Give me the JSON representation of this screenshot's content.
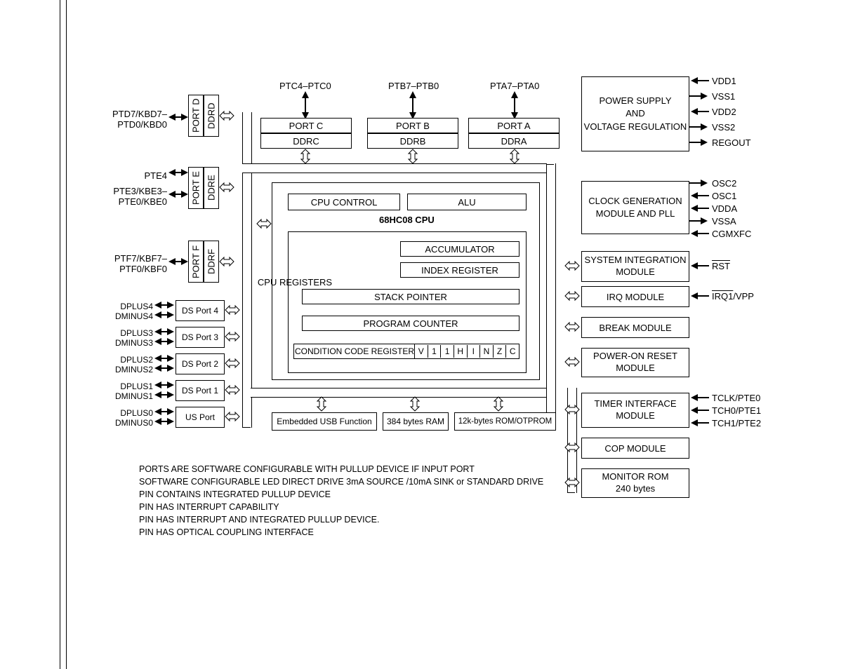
{
  "top_ports": {
    "ptc": "PTC4–PTC0",
    "ptb": "PTB7–PTB0",
    "pta": "PTA7–PTA0"
  },
  "portABC": {
    "portc": "PORT C",
    "ddrc": "DDRC",
    "portb": "PORT B",
    "ddrb": "DDRB",
    "porta": "PORT A",
    "ddra": "DDRA"
  },
  "left_ports": {
    "d": {
      "pin": "PTD7/KBD7–\nPTD0/KBD0",
      "port": "PORT D",
      "ddr": "DDRD"
    },
    "e": {
      "pin4": "PTE4",
      "pin": "PTE3/KBE3–\nPTE0/KBE0",
      "port": "PORT E",
      "ddr": "DDRE"
    },
    "f": {
      "pin": "PTF7/KBF7–\nPTF0/KBF0",
      "port": "PORT F",
      "ddr": "DDRF"
    }
  },
  "ds_ports": {
    "dp4": {
      "p": "DPLUS4",
      "m": "DMINUS4",
      "box": "DS Port 4"
    },
    "dp3": {
      "p": "DPLUS3",
      "m": "DMINUS3",
      "box": "DS Port 3"
    },
    "dp2": {
      "p": "DPLUS2",
      "m": "DMINUS2",
      "box": "DS Port 2"
    },
    "dp1": {
      "p": "DPLUS1",
      "m": "DMINUS1",
      "box": "DS Port 1"
    },
    "dp0": {
      "p": "DPLUS0",
      "m": "DMINUS0",
      "box": "US Port"
    }
  },
  "cpu": {
    "title": "68HC08 CPU",
    "ctrl": "CPU CONTROL",
    "alu": "ALU",
    "regs": "CPU REGISTERS",
    "acc": "ACCUMULATOR",
    "idx": "INDEX REGISTER",
    "sp": "STACK POINTER",
    "pc": "PROGRAM COUNTER",
    "ccr": "CONDITION CODE REGISTER",
    "ccr_bits": [
      "V",
      "1",
      "1",
      "H",
      "I",
      "N",
      "Z",
      "C"
    ]
  },
  "mem": {
    "usb": "Embedded USB Function",
    "ram": "384 bytes RAM",
    "rom": "12k-bytes ROM/OTPROM"
  },
  "power": {
    "title1": "POWER SUPPLY",
    "title2": "AND",
    "title3": "VOLTAGE REGULATION",
    "pins": [
      "VDD1",
      "VSS1",
      "VDD2",
      "VSS2",
      "REGOUT"
    ]
  },
  "clock": {
    "title1": "CLOCK GENERATION",
    "title2": "MODULE AND PLL",
    "pins": [
      "OSC2",
      "OSC1",
      "VDDA",
      "VSSA",
      "CGMXFC"
    ]
  },
  "modules": {
    "sim": {
      "t1": "SYSTEM INTEGRATION",
      "t2": "MODULE",
      "pin": "RST"
    },
    "irq": {
      "t": "IRQ MODULE",
      "pin": "IRQ1/VPP"
    },
    "brk": {
      "t": "BREAK MODULE"
    },
    "por": {
      "t1": "POWER-ON RESET",
      "t2": "MODULE"
    },
    "tim": {
      "t1": "TIMER INTERFACE",
      "t2": "MODULE",
      "pins": [
        "TCLK/PTE0",
        "TCH0/PTE1",
        "TCH1/PTE2"
      ]
    },
    "cop": {
      "t": "COP MODULE"
    },
    "mon": {
      "t1": "MONITOR ROM",
      "t2": "240 bytes"
    }
  },
  "notes": [
    "PORTS ARE SOFTWARE CONFIGURABLE WITH PULLUP DEVICE IF INPUT PORT",
    "SOFTWARE CONFIGURABLE LED DIRECT DRIVE 3mA SOURCE /10mA SINK or STANDARD DRIVE",
    "PIN CONTAINS INTEGRATED PULLUP DEVICE",
    "PIN HAS INTERRUPT CAPABILITY",
    "PIN HAS INTERRUPT AND INTEGRATED PULLUP DEVICE.",
    "PIN HAS OPTICAL COUPLING INTERFACE"
  ]
}
